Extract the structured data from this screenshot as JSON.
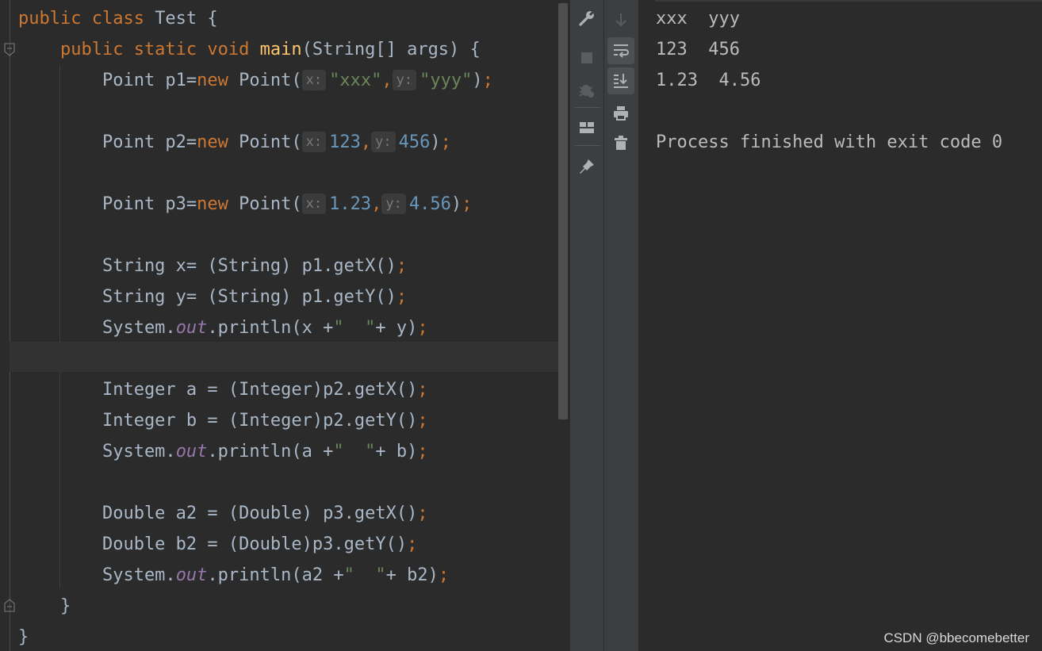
{
  "editor": {
    "lines": [
      {
        "segments": [
          {
            "t": "public class ",
            "c": "kw"
          },
          {
            "t": "Test {",
            "c": ""
          }
        ]
      },
      {
        "segments": [
          {
            "t": "    public static void ",
            "c": "kw"
          },
          {
            "t": "main",
            "c": "fn"
          },
          {
            "t": "(String[] args) {",
            "c": ""
          }
        ]
      },
      {
        "segments": [
          {
            "t": "        Point p1=",
            "c": ""
          },
          {
            "t": "new ",
            "c": "kw"
          },
          {
            "t": "Point(",
            "c": ""
          },
          {
            "t": "x:",
            "c": "hint"
          },
          {
            "t": "\"xxx\"",
            "c": "str"
          },
          {
            "t": ",",
            "c": "semi"
          },
          {
            "t": "y:",
            "c": "hint"
          },
          {
            "t": "\"yyy\"",
            "c": "str"
          },
          {
            "t": ")",
            "c": ""
          },
          {
            "t": ";",
            "c": "semi"
          }
        ]
      },
      {
        "segments": []
      },
      {
        "segments": [
          {
            "t": "        Point p2=",
            "c": ""
          },
          {
            "t": "new ",
            "c": "kw"
          },
          {
            "t": "Point(",
            "c": ""
          },
          {
            "t": "x:",
            "c": "hint"
          },
          {
            "t": "123",
            "c": "num"
          },
          {
            "t": ",",
            "c": "semi"
          },
          {
            "t": "y:",
            "c": "hint"
          },
          {
            "t": "456",
            "c": "num"
          },
          {
            "t": ")",
            "c": ""
          },
          {
            "t": ";",
            "c": "semi"
          }
        ]
      },
      {
        "segments": []
      },
      {
        "segments": [
          {
            "t": "        Point p3=",
            "c": ""
          },
          {
            "t": "new ",
            "c": "kw"
          },
          {
            "t": "Point(",
            "c": ""
          },
          {
            "t": "x:",
            "c": "hint"
          },
          {
            "t": "1.23",
            "c": "num"
          },
          {
            "t": ",",
            "c": "semi"
          },
          {
            "t": "y:",
            "c": "hint"
          },
          {
            "t": "4.56",
            "c": "num"
          },
          {
            "t": ")",
            "c": ""
          },
          {
            "t": ";",
            "c": "semi"
          }
        ]
      },
      {
        "segments": []
      },
      {
        "segments": [
          {
            "t": "        String x= (String) p1.getX()",
            "c": ""
          },
          {
            "t": ";",
            "c": "semi"
          }
        ]
      },
      {
        "segments": [
          {
            "t": "        String y= (String) p1.getY()",
            "c": ""
          },
          {
            "t": ";",
            "c": "semi"
          }
        ]
      },
      {
        "segments": [
          {
            "t": "        System.",
            "c": ""
          },
          {
            "t": "out",
            "c": "field"
          },
          {
            "t": ".println(x +",
            "c": ""
          },
          {
            "t": "\"  \"",
            "c": "str"
          },
          {
            "t": "+ y)",
            "c": ""
          },
          {
            "t": ";",
            "c": "semi"
          }
        ]
      },
      {
        "segments": []
      },
      {
        "segments": [
          {
            "t": "        Integer a = (Integer)p2.getX()",
            "c": ""
          },
          {
            "t": ";",
            "c": "semi"
          }
        ]
      },
      {
        "segments": [
          {
            "t": "        Integer b = (Integer)p2.getY()",
            "c": ""
          },
          {
            "t": ";",
            "c": "semi"
          }
        ]
      },
      {
        "segments": [
          {
            "t": "        System.",
            "c": ""
          },
          {
            "t": "out",
            "c": "field"
          },
          {
            "t": ".println(a +",
            "c": ""
          },
          {
            "t": "\"  \"",
            "c": "str"
          },
          {
            "t": "+ b)",
            "c": ""
          },
          {
            "t": ";",
            "c": "semi"
          }
        ]
      },
      {
        "segments": []
      },
      {
        "segments": [
          {
            "t": "        Double a2 = (Double) p3.getX()",
            "c": ""
          },
          {
            "t": ";",
            "c": "semi"
          }
        ]
      },
      {
        "segments": [
          {
            "t": "        Double b2 = (Double)p3.getY()",
            "c": ""
          },
          {
            "t": ";",
            "c": "semi"
          }
        ]
      },
      {
        "segments": [
          {
            "t": "        System.",
            "c": ""
          },
          {
            "t": "out",
            "c": "field"
          },
          {
            "t": ".println(a2 +",
            "c": ""
          },
          {
            "t": "\"  \"",
            "c": "str"
          },
          {
            "t": "+ b2)",
            "c": ""
          },
          {
            "t": ";",
            "c": "semi"
          }
        ]
      },
      {
        "segments": [
          {
            "t": "    }",
            "c": ""
          }
        ]
      },
      {
        "segments": [
          {
            "t": "}",
            "c": ""
          }
        ]
      }
    ]
  },
  "toolbar": {
    "left_icons": [
      "wrench-icon",
      "stop-icon",
      "debug-bug-icon",
      "layout-icon",
      "pin-icon"
    ],
    "right_icons": [
      "scroll-down-arrow-icon",
      "soft-wrap-icon",
      "scroll-to-end-icon",
      "print-icon",
      "trash-icon"
    ]
  },
  "console": {
    "lines": [
      "xxx  yyy",
      "123  456",
      "1.23  4.56",
      "",
      "Process finished with exit code 0"
    ]
  },
  "watermark": "CSDN @bbecomebetter",
  "colors": {
    "editor_bg": "#2b2b2b",
    "keyword": "#cc7832",
    "function": "#ffc66d",
    "string": "#6a8759",
    "number": "#6897bb",
    "field": "#9876aa",
    "text": "#a9b7c6",
    "toolbar_bg": "#3c3f41"
  }
}
